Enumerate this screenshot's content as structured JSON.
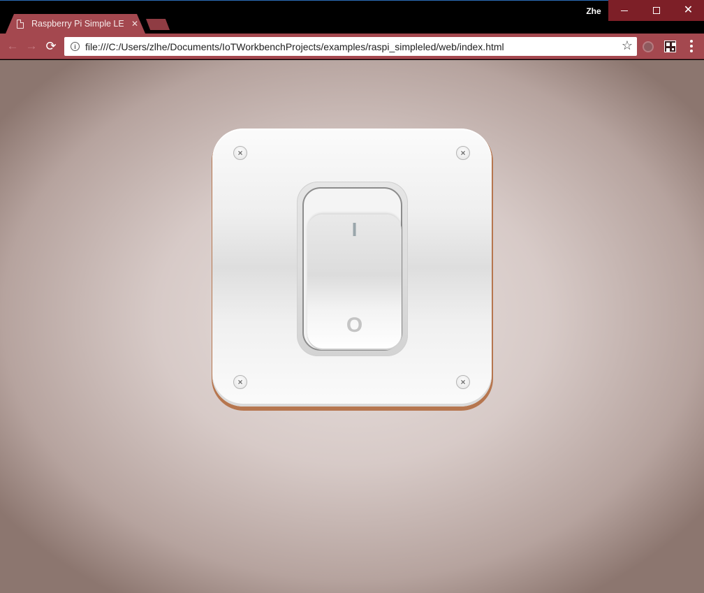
{
  "window": {
    "user_name": "Zhe",
    "close_glyph": "✕"
  },
  "tab": {
    "title": "Raspberry Pi Simple LED",
    "close_glyph": "✕"
  },
  "toolbar": {
    "back_glyph": "←",
    "forward_glyph": "→",
    "reload_glyph": "⟳",
    "url": "file:///C:/Users/zlhe/Documents/IoTWorkbenchProjects/examples/raspi_simpleled/web/index.html",
    "info_glyph": "i",
    "star_glyph": "☆"
  },
  "page": {
    "switch": {
      "on_label": "I",
      "off_label": "O",
      "screw_glyph": "×",
      "state": "off"
    }
  },
  "colors": {
    "frame": "#a4484f",
    "window_controls": "#7d1f27",
    "background_center": "#e8e0de",
    "background_edge": "#8c766f"
  }
}
